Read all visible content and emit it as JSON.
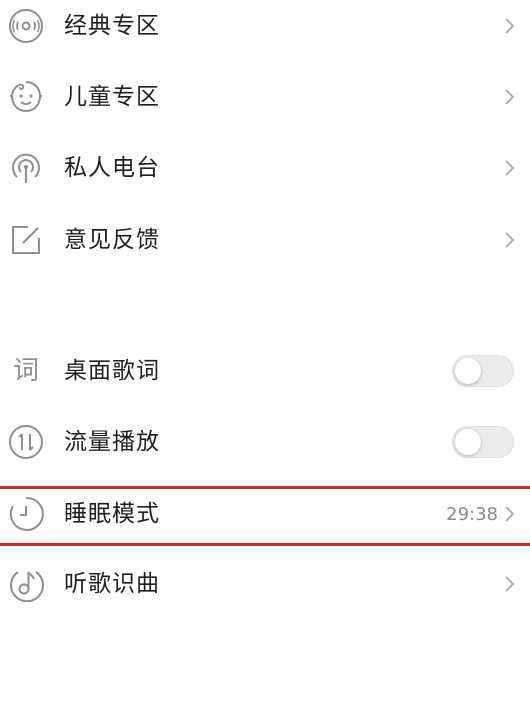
{
  "menu": {
    "items": [
      {
        "label": "经典专区",
        "icon": "vinyl-icon"
      },
      {
        "label": "儿童专区",
        "icon": "child-face-icon"
      },
      {
        "label": "私人电台",
        "icon": "radio-antenna-icon"
      },
      {
        "label": "意见反馈",
        "icon": "edit-icon"
      }
    ]
  },
  "settings": {
    "desktop_lyrics": {
      "label": "桌面歌词",
      "icon_glyph": "词",
      "enabled": false
    },
    "data_playback": {
      "label": "流量播放",
      "icon": "data-arrows-icon",
      "enabled": false
    },
    "sleep_mode": {
      "label": "睡眠模式",
      "icon": "clock-icon",
      "value": "29:38"
    },
    "song_recognition": {
      "label": "听歌识曲",
      "icon": "music-note-icon"
    }
  },
  "colors": {
    "highlight": "#d42a2a",
    "icon": "#8f8f8f",
    "chevron": "#a8a8a8",
    "toggle_off": "#ececec"
  }
}
